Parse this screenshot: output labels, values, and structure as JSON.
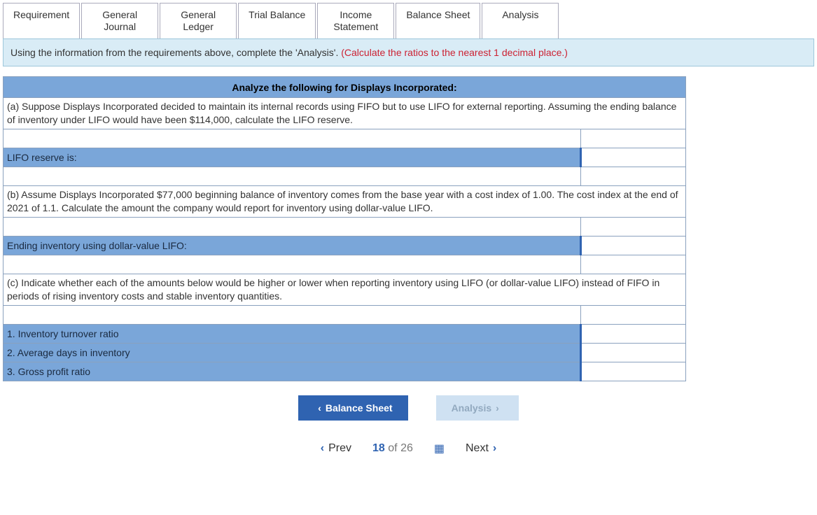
{
  "tabs": [
    {
      "label": "Requirement"
    },
    {
      "label": "General\nJournal"
    },
    {
      "label": "General\nLedger"
    },
    {
      "label": "Trial Balance"
    },
    {
      "label": "Income\nStatement"
    },
    {
      "label": "Balance Sheet"
    },
    {
      "label": "Analysis"
    }
  ],
  "instructions": {
    "main": "Using the information from the requirements above, complete the 'Analysis'. ",
    "red": "(Calculate the ratios to the nearest 1 decimal place.)"
  },
  "table": {
    "header": "Analyze the following for Displays Incorporated:",
    "part_a": "(a) Suppose Displays Incorporated decided to maintain its internal records using FIFO but to use LIFO for external reporting. Assuming the ending balance of inventory under LIFO would have been $114,000, calculate the LIFO reserve.",
    "a_label": "LIFO reserve is:",
    "part_b": "(b) Assume Displays Incorporated $77,000 beginning balance of inventory comes from the base year with a cost index of 1.00. The cost index at the end of 2021 of 1.1. Calculate the amount the company would report for inventory using dollar-value LIFO.",
    "b_label": "Ending inventory using dollar-value LIFO:",
    "part_c": "(c) Indicate whether each of the amounts below would be higher or lower when reporting inventory using LIFO (or dollar-value LIFO) instead of FIFO in periods of rising inventory costs and stable inventory quantities.",
    "c1": "1. Inventory turnover ratio",
    "c2": "2. Average days in inventory",
    "c3": "3. Gross profit ratio"
  },
  "nav": {
    "prev": "Balance Sheet",
    "next": "Analysis"
  },
  "pager": {
    "prev": "Prev",
    "current": "18",
    "of": "of",
    "total": "26",
    "next": "Next"
  }
}
